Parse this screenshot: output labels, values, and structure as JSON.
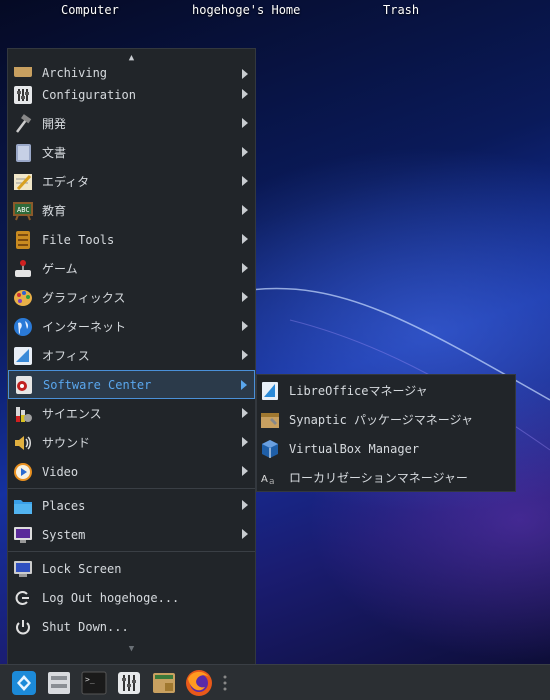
{
  "desktop": {
    "icons": [
      {
        "label": "Computer"
      },
      {
        "label": "hogehoge's Home"
      },
      {
        "label": "Trash"
      }
    ]
  },
  "menu": {
    "scroll_up": "▲",
    "scroll_down": "▼",
    "categories": [
      {
        "label": "Archiving",
        "icon": "archive-icon"
      },
      {
        "label": "Configuration",
        "icon": "configuration-icon"
      },
      {
        "label": "開発",
        "icon": "development-icon"
      },
      {
        "label": "文書",
        "icon": "document-icon"
      },
      {
        "label": "エディタ",
        "icon": "editor-icon"
      },
      {
        "label": "教育",
        "icon": "education-icon"
      },
      {
        "label": "File Tools",
        "icon": "file-tools-icon"
      },
      {
        "label": "ゲーム",
        "icon": "game-icon"
      },
      {
        "label": "グラフィックス",
        "icon": "graphics-icon"
      },
      {
        "label": "インターネット",
        "icon": "internet-icon"
      },
      {
        "label": "オフィス",
        "icon": "office-icon"
      },
      {
        "label": "Software Center",
        "icon": "software-center-icon"
      },
      {
        "label": "サイエンス",
        "icon": "science-icon"
      },
      {
        "label": "サウンド",
        "icon": "sound-icon"
      },
      {
        "label": "Video",
        "icon": "video-icon"
      }
    ],
    "places": [
      {
        "label": "Places",
        "icon": "folder-icon"
      },
      {
        "label": "System",
        "icon": "system-icon"
      }
    ],
    "session": [
      {
        "label": "Lock Screen",
        "icon": "lock-screen-icon"
      },
      {
        "label": "Log Out hogehoge...",
        "icon": "logout-icon"
      },
      {
        "label": "Shut Down...",
        "icon": "power-icon"
      }
    ]
  },
  "submenu": {
    "items": [
      {
        "label": "LibreOfficeマネージャ",
        "icon": "libreoffice-icon"
      },
      {
        "label": "Synaptic パッケージマネージャ",
        "icon": "synaptic-icon"
      },
      {
        "label": "VirtualBox Manager",
        "icon": "virtualbox-icon"
      },
      {
        "label": "ローカリゼーションマネージャー",
        "icon": "localization-icon"
      }
    ]
  },
  "panel": {
    "items": [
      {
        "icon": "app-menu-icon"
      },
      {
        "icon": "file-manager-icon"
      },
      {
        "icon": "terminal-icon"
      },
      {
        "icon": "settings-mixer-icon"
      },
      {
        "icon": "archive-manager-icon"
      },
      {
        "icon": "firefox-icon"
      },
      {
        "icon": "panel-separator-icon"
      }
    ]
  },
  "colors": {
    "accent": "#4a90d9",
    "menu_bg": "#212529",
    "active_text": "#5aa7ee"
  }
}
